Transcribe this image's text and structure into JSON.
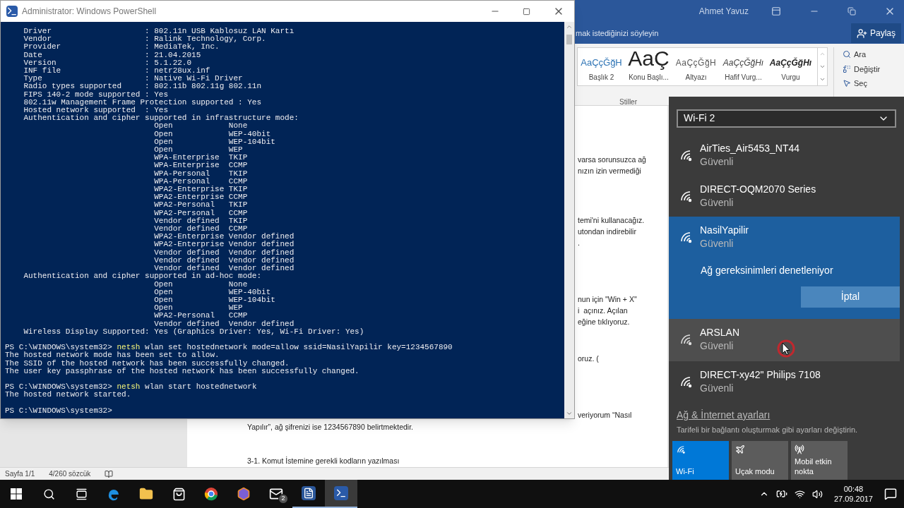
{
  "word": {
    "user": "Ahmet Yavuz",
    "tell_me": "mak istediğinizi söyleyin",
    "share": "Paylaş",
    "styles": [
      {
        "kind": "heading2",
        "preview": "AaÇçĞğH",
        "name": "Başlık 2"
      },
      {
        "kind": "title",
        "preview": "AaÇ",
        "name": "Konu Başlı..."
      },
      {
        "kind": "subtitle",
        "preview": "AaÇçĞğH",
        "name": "Altyazı"
      },
      {
        "kind": "subtle_emphasis",
        "preview": "AaÇçĞğHı",
        "name": "Hafif Vurg..."
      },
      {
        "kind": "emphasis",
        "preview": "AaÇçĞğHı",
        "name": "Vurgu"
      }
    ],
    "styles_group": "Stiller",
    "editing": [
      {
        "kind": "find",
        "label": "Ara"
      },
      {
        "kind": "replace",
        "label": "Değiştir"
      },
      {
        "kind": "select",
        "label": "Seç"
      }
    ],
    "fragments": [
      [
        "varsa sorunsuzca ağ",
        "nızın izin vermediği"
      ],
      [
        "temi'ni kullanacağız.",
        "utondan indirebilir",
        "."
      ],
      [
        "nun için \"Win + X\"",
        "i  açınız. Açılan",
        "eğine tıklıyoruz."
      ],
      [
        "oruz. ("
      ],
      [
        "veriyorum “Nasıl"
      ]
    ],
    "paragraphs": [
      "Yapılır”, ağ şifrenizi ise 1234567890 belirtmektedir.",
      "3-1. Komut İstemine gerekli kodların yazılması"
    ],
    "status": [
      "Sayfa 1/1",
      "4/260 sözcük"
    ]
  },
  "powershell": {
    "title": "Administrator: Windows PowerShell",
    "lines": [
      {
        "kind": "field",
        "label": "Driver",
        "value": ": 802.11n USB Kablosuz LAN Kartı"
      },
      {
        "kind": "field",
        "label": "Vendor",
        "value": ": Ralink Technology, Corp."
      },
      {
        "kind": "field",
        "label": "Provider",
        "value": ": MediaTek, Inc."
      },
      {
        "kind": "field",
        "label": "Date",
        "value": ": 21.04.2015"
      },
      {
        "kind": "field",
        "label": "Version",
        "value": ": 5.1.22.0"
      },
      {
        "kind": "field",
        "label": "INF file",
        "value": ": netr28ux.inf"
      },
      {
        "kind": "field",
        "label": "Type",
        "value": ": Native Wi-Fi Driver"
      },
      {
        "kind": "field",
        "label": "Radio types supported",
        "value": ": 802.11b 802.11g 802.11n"
      },
      {
        "kind": "field",
        "label": "FIPS 140-2 mode supported",
        "value": ": Yes"
      },
      {
        "kind": "heading",
        "text": "802.11w Management Frame Protection supported : Yes"
      },
      {
        "kind": "field",
        "label": "Hosted network supported",
        "value": ": Yes"
      },
      {
        "kind": "heading",
        "text": "Authentication and cipher supported in infrastructure mode:"
      },
      {
        "kind": "cipher",
        "auth": "Open",
        "cipher": "None"
      },
      {
        "kind": "cipher",
        "auth": "Open",
        "cipher": "WEP-40bit"
      },
      {
        "kind": "cipher",
        "auth": "Open",
        "cipher": "WEP-104bit"
      },
      {
        "kind": "cipher",
        "auth": "Open",
        "cipher": "WEP"
      },
      {
        "kind": "cipher",
        "auth": "WPA-Enterprise",
        "cipher": "TKIP"
      },
      {
        "kind": "cipher",
        "auth": "WPA-Enterprise",
        "cipher": "CCMP"
      },
      {
        "kind": "cipher",
        "auth": "WPA-Personal",
        "cipher": "TKIP"
      },
      {
        "kind": "cipher",
        "auth": "WPA-Personal",
        "cipher": "CCMP"
      },
      {
        "kind": "cipher",
        "auth": "WPA2-Enterprise",
        "cipher": "TKIP"
      },
      {
        "kind": "cipher",
        "auth": "WPA2-Enterprise",
        "cipher": "CCMP"
      },
      {
        "kind": "cipher",
        "auth": "WPA2-Personal",
        "cipher": "TKIP"
      },
      {
        "kind": "cipher",
        "auth": "WPA2-Personal",
        "cipher": "CCMP"
      },
      {
        "kind": "cipher",
        "auth": "Vendor defined",
        "cipher": "TKIP"
      },
      {
        "kind": "cipher",
        "auth": "Vendor defined",
        "cipher": "CCMP"
      },
      {
        "kind": "cipher",
        "auth": "WPA2-Enterprise",
        "cipher": "Vendor defined"
      },
      {
        "kind": "cipher",
        "auth": "WPA2-Enterprise",
        "cipher": "Vendor defined"
      },
      {
        "kind": "cipher",
        "auth": "Vendor defined",
        "cipher": "Vendor defined"
      },
      {
        "kind": "cipher",
        "auth": "Vendor defined",
        "cipher": "Vendor defined"
      },
      {
        "kind": "cipher",
        "auth": "Vendor defined",
        "cipher": "Vendor defined"
      },
      {
        "kind": "heading",
        "text": "Authentication and cipher supported in ad-hoc mode:"
      },
      {
        "kind": "cipher",
        "auth": "Open",
        "cipher": "None"
      },
      {
        "kind": "cipher",
        "auth": "Open",
        "cipher": "WEP-40bit"
      },
      {
        "kind": "cipher",
        "auth": "Open",
        "cipher": "WEP-104bit"
      },
      {
        "kind": "cipher",
        "auth": "Open",
        "cipher": "WEP"
      },
      {
        "kind": "cipher",
        "auth": "WPA2-Personal",
        "cipher": "CCMP"
      },
      {
        "kind": "cipher",
        "auth": "Vendor defined",
        "cipher": "Vendor defined"
      },
      {
        "kind": "heading",
        "text": "Wireless Display Supported: Yes (Graphics Driver: Yes, Wi-Fi Driver: Yes)"
      },
      {
        "kind": "blank"
      },
      {
        "kind": "prompt",
        "prompt": "PS C:\\WINDOWS\\system32> ",
        "command": "netsh",
        "args": " wlan set hostednetwork mode=allow ssid=NasilYapilir key=1234567890"
      },
      {
        "kind": "output",
        "text": "The hosted network mode has been set to allow."
      },
      {
        "kind": "output",
        "text": "The SSID of the hosted network has been successfully changed."
      },
      {
        "kind": "output",
        "text": "The user key passphrase of the hosted network has been successfully changed."
      },
      {
        "kind": "blank"
      },
      {
        "kind": "prompt",
        "prompt": "PS C:\\WINDOWS\\system32> ",
        "command": "netsh",
        "args": " wlan start hostednetwork"
      },
      {
        "kind": "output",
        "text": "The hosted network started."
      },
      {
        "kind": "blank"
      },
      {
        "kind": "output",
        "text": "PS C:\\WINDOWS\\system32>"
      }
    ]
  },
  "wifi": {
    "adapter": "Wi-Fi 2",
    "networks": [
      {
        "name": "AirTies_Air5453_NT44",
        "status": "Güvenli",
        "selected": false,
        "hovered": false
      },
      {
        "name": "DIRECT-OQM2070 Series",
        "status": "Güvenli",
        "selected": false,
        "hovered": false
      },
      {
        "name": "NasilYapilir",
        "status": "Güvenli",
        "selected": true,
        "hovered": false,
        "message": "Ağ gereksinimleri denetleniyor",
        "action": "İptal"
      },
      {
        "name": "ARSLAN",
        "status": "Güvenli",
        "selected": false,
        "hovered": true
      },
      {
        "name": "DIRECT-xy42\" Philips 7108",
        "status": "Güvenli",
        "selected": false,
        "hovered": false
      }
    ],
    "settings_link": "Ağ & İnternet ayarları",
    "settings_hint": "Tarifeli bir bağlantı oluşturmak gibi ayarları değiştirin.",
    "quick_actions": [
      {
        "kind": "wifi",
        "label": "Wi-Fi",
        "on": true
      },
      {
        "kind": "airplane",
        "label": "Uçak modu",
        "on": false
      },
      {
        "kind": "hotspot",
        "label": "Mobil etkin nokta",
        "on": false
      }
    ]
  },
  "taskbar": {
    "items": [
      {
        "kind": "start",
        "running": false,
        "active": false
      },
      {
        "kind": "search",
        "running": false,
        "active": false
      },
      {
        "kind": "taskview",
        "running": false,
        "active": false
      },
      {
        "kind": "edge",
        "running": false,
        "active": false
      },
      {
        "kind": "explorer",
        "running": false,
        "active": false
      },
      {
        "kind": "store",
        "running": false,
        "active": false
      },
      {
        "kind": "chrome",
        "running": false,
        "active": false
      },
      {
        "kind": "app",
        "running": false,
        "active": false
      },
      {
        "kind": "mail",
        "running": false,
        "active": false,
        "badge": "2"
      },
      {
        "kind": "word",
        "running": true,
        "active": false
      },
      {
        "kind": "powershell",
        "running": true,
        "active": true
      }
    ],
    "time": "00:48",
    "date": "27.09.2017"
  }
}
